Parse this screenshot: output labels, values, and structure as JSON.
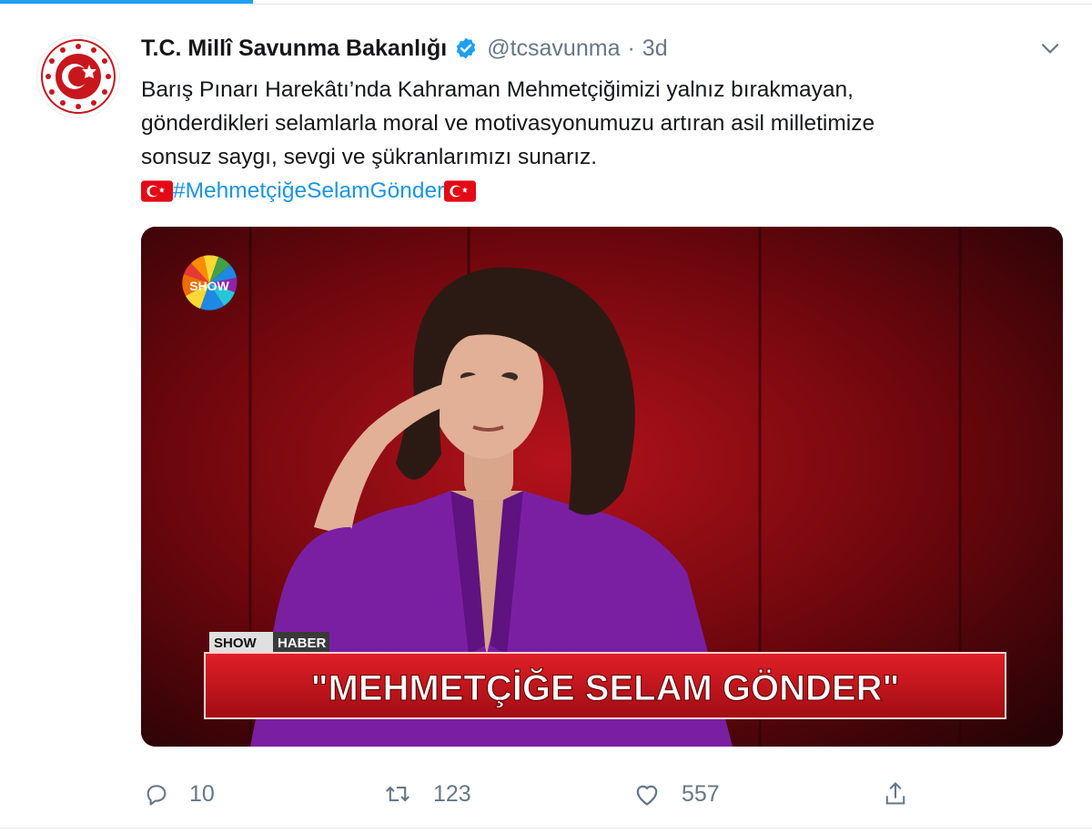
{
  "tweet": {
    "display_name": "T.C. Millî Savunma Bakanlığı",
    "handle": "@tcsavunma",
    "separator": "·",
    "time": "3d",
    "text_lines": [
      "Barış Pınarı Harekâtı’nda Kahraman Mehmetçiğimizi yalnız bırakmayan,",
      "gönderdikleri selamlarla moral ve motivasyonumuzu artıran asil milletimize",
      "sonsuz saygı, sevgi ve şükranlarımızı sunarız."
    ],
    "hashtag": "#MehmetçiğeSelamGönder"
  },
  "media": {
    "logo_text": "SHOW",
    "tag_show": "SHOW",
    "tag_haber": "HABER",
    "banner_text": "\"MEHMETÇİĞE SELAM GÖNDER\""
  },
  "actions": {
    "replies": "10",
    "retweets": "123",
    "likes": "557"
  },
  "colors": {
    "accent": "#1da1f2",
    "hashtag": "#1b95e0",
    "muted": "#657786",
    "banner_red": "#c8161d"
  },
  "icons": [
    "seal-icon",
    "verified-badge-icon",
    "chevron-down-icon",
    "turkish-flag-icon",
    "reply-icon",
    "retweet-icon",
    "like-icon",
    "share-icon"
  ]
}
